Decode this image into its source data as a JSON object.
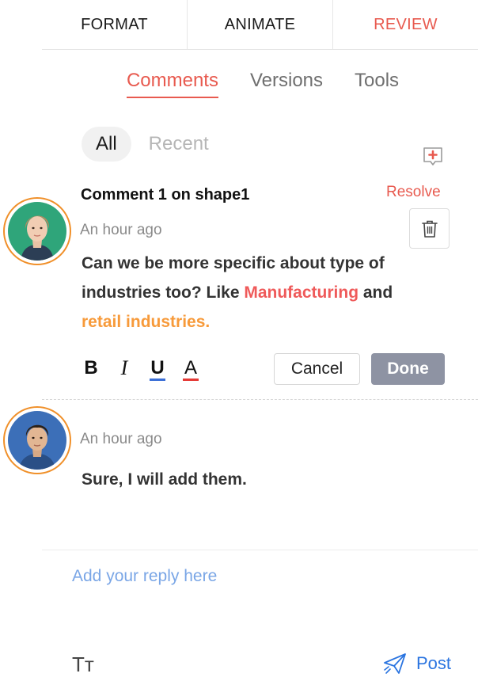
{
  "top_tabs": [
    {
      "label": "FORMAT",
      "active": false
    },
    {
      "label": "ANIMATE",
      "active": false
    },
    {
      "label": "REVIEW",
      "active": true
    }
  ],
  "sub_tabs": [
    {
      "label": "Comments",
      "active": true
    },
    {
      "label": "Versions",
      "active": false
    },
    {
      "label": "Tools",
      "active": false
    }
  ],
  "filters": [
    {
      "label": "All",
      "active": true
    },
    {
      "label": "Recent",
      "active": false
    }
  ],
  "comment1": {
    "title": "Comment 1 on shape1",
    "time": "An hour ago",
    "resolve_label": "Resolve",
    "body_plain_1": "Can we be more specific about type of industries too? Like ",
    "highlight_1": "Manufacturing",
    "body_plain_2": " and ",
    "highlight_2": "retail industries."
  },
  "format_bar": {
    "bold": "B",
    "italic": "I",
    "underline": "U",
    "font_color": "A"
  },
  "actions": {
    "cancel": "Cancel",
    "done": "Done"
  },
  "comment2": {
    "time": "An hour ago",
    "body": "Sure, I will add them."
  },
  "reply": {
    "placeholder": "Add your reply here",
    "post_label": "Post",
    "text_size_icon": "Tт"
  },
  "colors": {
    "accent": "#e85a4f",
    "link_blue": "#2a74e0",
    "avatar_ring": "#f0902a",
    "done_button": "#8e93a3"
  }
}
